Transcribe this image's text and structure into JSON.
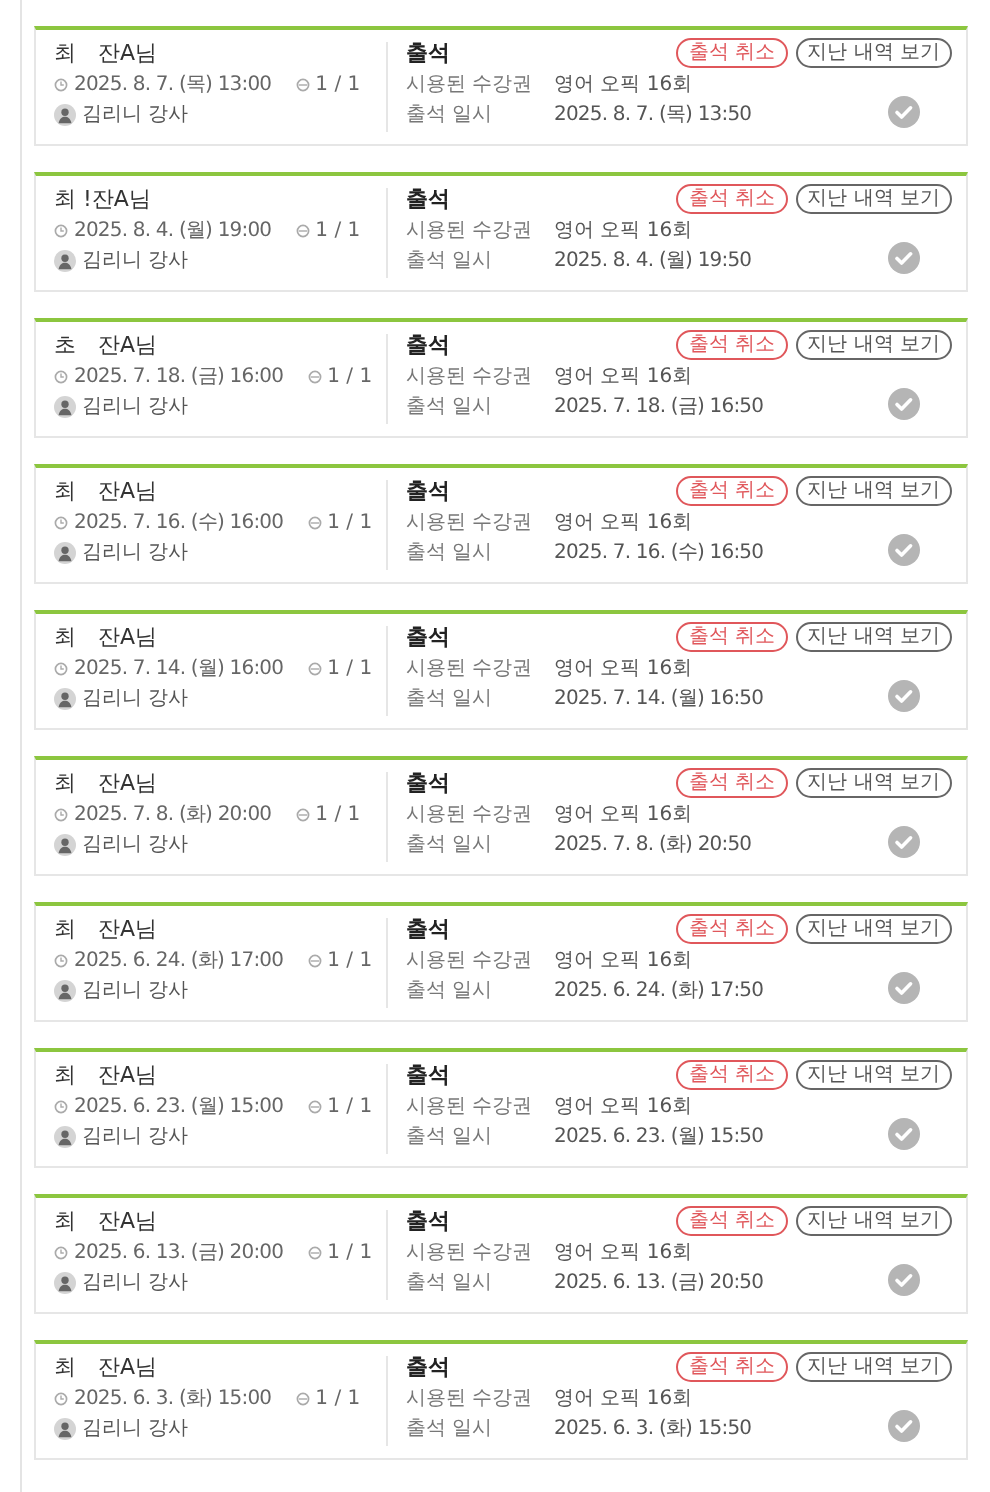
{
  "records": [
    {
      "student": "최　잔A님",
      "schedule": "2025. 8. 7. (목) 13:00",
      "count": "1 / 1",
      "teacher": "김리니 강사",
      "status": "출석",
      "ticket_label": "시용된 수강권",
      "ticket": "영어 오픽 16회",
      "time_label": "출석 일시",
      "time": "2025. 8. 7. (목) 13:50",
      "cancel": "출석 취소",
      "history": "지난 내역 보기"
    },
    {
      "student": "최 !잔A님",
      "schedule": "2025. 8. 4. (월) 19:00",
      "count": "1 / 1",
      "teacher": "김리니 강사",
      "status": "출석",
      "ticket_label": "시용된 수강권",
      "ticket": "영어 오픽 16회",
      "time_label": "출석 일시",
      "time": "2025. 8. 4. (월) 19:50",
      "cancel": "출석 취소",
      "history": "지난 내역 보기"
    },
    {
      "student": "초　잔A님",
      "schedule": "2025. 7. 18. (금) 16:00",
      "count": "1 / 1",
      "teacher": "김리니 강사",
      "status": "출석",
      "ticket_label": "시용된 수강권",
      "ticket": "영어 오픽 16회",
      "time_label": "출석 일시",
      "time": "2025. 7. 18. (금) 16:50",
      "cancel": "출석 취소",
      "history": "지난 내역 보기"
    },
    {
      "student": "최　잔A님",
      "schedule": "2025. 7. 16. (수) 16:00",
      "count": "1 / 1",
      "teacher": "김리니 강사",
      "status": "출석",
      "ticket_label": "시용된 수강권",
      "ticket": "영어 오픽 16회",
      "time_label": "출석 일시",
      "time": "2025. 7. 16. (수) 16:50",
      "cancel": "출석 취소",
      "history": "지난 내역 보기"
    },
    {
      "student": "최　잔A님",
      "schedule": "2025. 7. 14. (월) 16:00",
      "count": "1 / 1",
      "teacher": "김리니 강사",
      "status": "출석",
      "ticket_label": "시용된 수강권",
      "ticket": "영어 오픽 16회",
      "time_label": "출석 일시",
      "time": "2025. 7. 14. (월) 16:50",
      "cancel": "출석 취소",
      "history": "지난 내역 보기"
    },
    {
      "student": "최　잔A님",
      "schedule": "2025. 7. 8. (화) 20:00",
      "count": "1 / 1",
      "teacher": "김리니 강사",
      "status": "출석",
      "ticket_label": "시용된 수강권",
      "ticket": "영어 오픽 16회",
      "time_label": "출석 일시",
      "time": "2025. 7. 8. (화) 20:50",
      "cancel": "출석 취소",
      "history": "지난 내역 보기"
    },
    {
      "student": "최　잔A님",
      "schedule": "2025. 6. 24. (화) 17:00",
      "count": "1 / 1",
      "teacher": "김리니 강사",
      "status": "출석",
      "ticket_label": "시용된 수강권",
      "ticket": "영어 오픽 16회",
      "time_label": "출석 일시",
      "time": "2025. 6. 24. (화) 17:50",
      "cancel": "출석 취소",
      "history": "지난 내역 보기"
    },
    {
      "student": "최　잔A님",
      "schedule": "2025. 6. 23. (월) 15:00",
      "count": "1 / 1",
      "teacher": "김리니 강사",
      "status": "출석",
      "ticket_label": "시용된 수강권",
      "ticket": "영어 오픽 16회",
      "time_label": "출석 일시",
      "time": "2025. 6. 23. (월) 15:50",
      "cancel": "출석 취소",
      "history": "지난 내역 보기"
    },
    {
      "student": "최　잔A님",
      "schedule": "2025. 6. 13. (금) 20:00",
      "count": "1 / 1",
      "teacher": "김리니 강사",
      "status": "출석",
      "ticket_label": "시용된 수강권",
      "ticket": "영어 오픽 16회",
      "time_label": "출석 일시",
      "time": "2025. 6. 13. (금) 20:50",
      "cancel": "출석 취소",
      "history": "지난 내역 보기"
    },
    {
      "student": "최　잔A님",
      "schedule": "2025. 6. 3. (화) 15:00",
      "count": "1 / 1",
      "teacher": "김리니 강사",
      "status": "출석",
      "ticket_label": "시용된 수강권",
      "ticket": "영어 오픽 16회",
      "time_label": "출석 일시",
      "time": "2025. 6. 3. (화) 15:50",
      "cancel": "출석 취소",
      "history": "지난 내역 보기"
    }
  ]
}
